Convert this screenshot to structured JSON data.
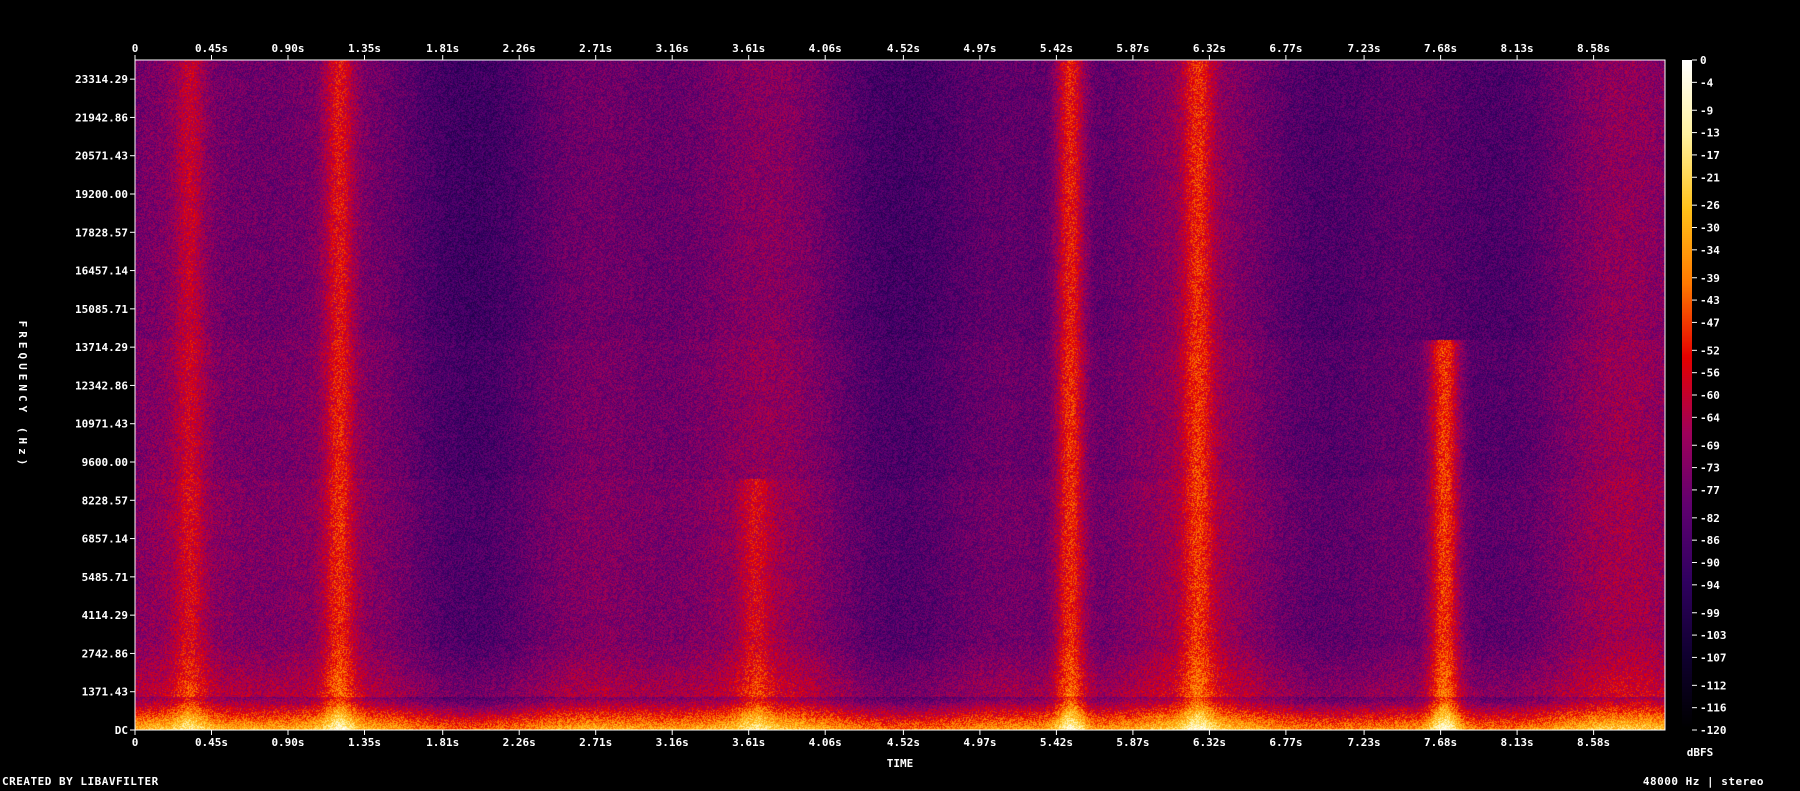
{
  "footer": {
    "credit": "CREATED BY LIBAVFILTER",
    "info": "48000 Hz | stereo"
  },
  "chart_data": {
    "type": "heatmap",
    "title": "",
    "xlabel": "TIME",
    "ylabel": "FREQUENCY (Hz)",
    "x_unit": "s",
    "xlim": [
      0,
      9.0
    ],
    "ylim": [
      0,
      24000
    ],
    "x_ticks": [
      "0",
      "0.45s",
      "0.90s",
      "1.35s",
      "1.81s",
      "2.26s",
      "2.71s",
      "3.16s",
      "3.61s",
      "4.06s",
      "4.52s",
      "4.97s",
      "5.42s",
      "5.87s",
      "6.32s",
      "6.77s",
      "7.23s",
      "7.68s",
      "8.13s",
      "8.58s"
    ],
    "x_tick_values": [
      0,
      0.45,
      0.9,
      1.35,
      1.81,
      2.26,
      2.71,
      3.16,
      3.61,
      4.06,
      4.52,
      4.97,
      5.42,
      5.87,
      6.32,
      6.77,
      7.23,
      7.68,
      8.13,
      8.58
    ],
    "y_ticks": [
      "DC",
      "1371.43",
      "2742.86",
      "4114.29",
      "5485.71",
      "6857.14",
      "8228.57",
      "9600.00",
      "10971.43",
      "12342.86",
      "13714.29",
      "15085.71",
      "16457.14",
      "17828.57",
      "19200.00",
      "20571.43",
      "21942.86",
      "23314.29"
    ],
    "y_tick_values": [
      0,
      1371.43,
      2742.86,
      4114.29,
      5485.71,
      6857.14,
      8228.57,
      9600.0,
      10971.43,
      12342.86,
      13714.29,
      15085.71,
      16457.14,
      17828.57,
      19200.0,
      20571.43,
      21942.86,
      23314.29
    ],
    "colorbar": {
      "label": "dBFS",
      "range": [
        -120,
        0
      ],
      "ticks": [
        "0",
        "-4",
        "-9",
        "-13",
        "-17",
        "-21",
        "-26",
        "-30",
        "-34",
        "-39",
        "-43",
        "-47",
        "-52",
        "-56",
        "-60",
        "-64",
        "-69",
        "-73",
        "-77",
        "-82",
        "-86",
        "-90",
        "-94",
        "-99",
        "-103",
        "-107",
        "-112",
        "-116",
        "-120"
      ],
      "tick_values": [
        0,
        -4,
        -9,
        -13,
        -17,
        -21,
        -26,
        -30,
        -34,
        -39,
        -43,
        -47,
        -52,
        -56,
        -60,
        -64,
        -69,
        -73,
        -77,
        -82,
        -86,
        -90,
        -94,
        -99,
        -103,
        -107,
        -112,
        -116,
        -120
      ],
      "colors": [
        "#ffffff",
        "#fff2a0",
        "#ffc21a",
        "#ff7a00",
        "#e60000",
        "#a0005a",
        "#600070",
        "#300060",
        "#100030",
        "#000000"
      ]
    },
    "background_level_db": -88,
    "events": [
      {
        "t": 0.32,
        "f_max": 24000,
        "level_db": -68
      },
      {
        "t": 1.2,
        "f_max": 24000,
        "level_db": -60
      },
      {
        "t": 3.65,
        "f_max": 9000,
        "level_db": -64
      },
      {
        "t": 5.5,
        "f_max": 24000,
        "level_db": -56
      },
      {
        "t": 6.25,
        "f_max": 24000,
        "level_db": -52
      },
      {
        "t": 7.7,
        "f_max": 14000,
        "level_db": -50
      }
    ]
  }
}
